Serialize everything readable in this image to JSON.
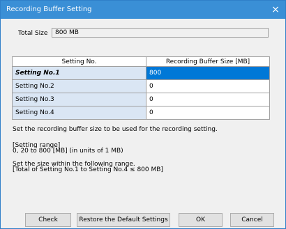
{
  "window": {
    "title": "Recording Buffer Setting",
    "close_icon": "×"
  },
  "total_size": {
    "label": "Total Size",
    "value": "800 MB"
  },
  "grid": {
    "headers": [
      "Setting No.",
      "Recording Buffer Size [MB]"
    ],
    "rows": [
      {
        "name": "Setting No.1",
        "value": "800"
      },
      {
        "name": "Setting No.2",
        "value": "0"
      },
      {
        "name": "Setting No.3",
        "value": "0"
      },
      {
        "name": "Setting No.4",
        "value": "0"
      }
    ],
    "selected_row": 0
  },
  "description": "Set the recording buffer size to be used for the recording setting.",
  "range_title": "[Setting range]",
  "range_value": "0, 20 to 800 [MB] (in units of 1 MB)",
  "within_line1": "Set the size within the following range.",
  "within_line2": "[Total of Setting No.1 to Setting No.4 ≤ 800 MB]",
  "buttons": {
    "check": "Check",
    "restore": "Restore the Default Settings",
    "ok": "OK",
    "cancel": "Cancel"
  },
  "colors": {
    "title_bar": "#3a8fd6",
    "selection": "#0078d7",
    "row_header": "#dae6f4"
  }
}
